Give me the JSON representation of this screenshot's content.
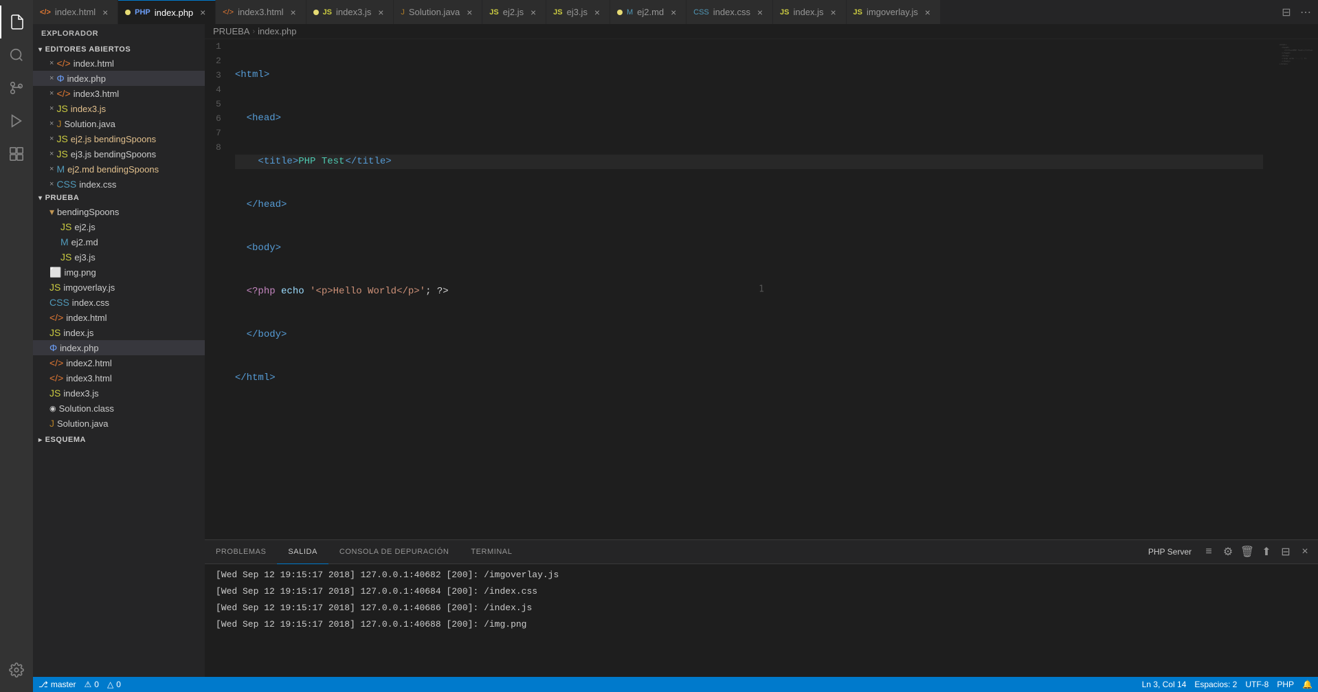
{
  "activityBar": {
    "icons": [
      {
        "name": "files-icon",
        "symbol": "⎘",
        "active": true
      },
      {
        "name": "search-icon",
        "symbol": "🔍",
        "active": false
      },
      {
        "name": "source-control-icon",
        "symbol": "⎇",
        "active": false
      },
      {
        "name": "debug-icon",
        "symbol": "▶",
        "active": false
      },
      {
        "name": "extensions-icon",
        "symbol": "⊞",
        "active": false
      }
    ],
    "bottomIcons": [
      {
        "name": "settings-icon",
        "symbol": "⚙",
        "active": false
      }
    ]
  },
  "sidebar": {
    "title": "EXPLORADOR",
    "sections": {
      "openEditors": {
        "label": "EDITORES ABIERTOS",
        "files": [
          {
            "name": "index.html",
            "icon": "html",
            "modified": false,
            "indent": 1
          },
          {
            "name": "index.php",
            "icon": "php",
            "modified": true,
            "indent": 1,
            "active": true
          },
          {
            "name": "index3.html",
            "icon": "html",
            "modified": false,
            "indent": 1
          },
          {
            "name": "index3.js",
            "icon": "js",
            "modified": true,
            "indent": 1
          },
          {
            "name": "Solution.java",
            "icon": "java",
            "modified": false,
            "indent": 1
          },
          {
            "name": "ej2.js bendingSpoons",
            "icon": "js",
            "modified": true,
            "indent": 1
          },
          {
            "name": "ej3.js bendingSpoons",
            "icon": "js",
            "modified": false,
            "indent": 1
          },
          {
            "name": "ej2.md bendingSpoons",
            "icon": "md",
            "modified": true,
            "indent": 1
          },
          {
            "name": "index.css",
            "icon": "css",
            "modified": false,
            "indent": 1
          }
        ]
      },
      "prueba": {
        "label": "PRUEBA",
        "items": [
          {
            "name": "bendingSpoons",
            "icon": "folder",
            "indent": 1
          },
          {
            "name": "ej2.js",
            "icon": "js",
            "indent": 2
          },
          {
            "name": "ej2.md",
            "icon": "md",
            "indent": 2
          },
          {
            "name": "ej3.js",
            "icon": "js",
            "indent": 2
          },
          {
            "name": "img.png",
            "icon": "png",
            "indent": 1
          },
          {
            "name": "imgoverlay.js",
            "icon": "js",
            "indent": 1
          },
          {
            "name": "index.css",
            "icon": "css",
            "indent": 1
          },
          {
            "name": "index.html",
            "icon": "html",
            "indent": 1
          },
          {
            "name": "index.js",
            "icon": "js",
            "indent": 1
          },
          {
            "name": "index.php",
            "icon": "php",
            "indent": 1,
            "active": true
          },
          {
            "name": "index2.html",
            "icon": "html",
            "indent": 1
          },
          {
            "name": "index3.html",
            "icon": "html",
            "indent": 1
          },
          {
            "name": "index3.js",
            "icon": "js",
            "indent": 1
          },
          {
            "name": "Solution.class",
            "icon": "class",
            "indent": 1
          },
          {
            "name": "Solution.java",
            "icon": "java",
            "indent": 1
          }
        ]
      },
      "schema": {
        "label": "ESQUEMA"
      }
    }
  },
  "tabs": [
    {
      "name": "index.html",
      "icon": "html",
      "active": false,
      "modified": false
    },
    {
      "name": "index.php",
      "icon": "php",
      "active": true,
      "modified": true
    },
    {
      "name": "index3.html",
      "icon": "html",
      "active": false,
      "modified": false
    },
    {
      "name": "index3.js",
      "icon": "js",
      "active": false,
      "modified": true
    },
    {
      "name": "Solution.java",
      "icon": "java",
      "active": false,
      "modified": false
    },
    {
      "name": "ej2.js",
      "icon": "js",
      "active": false,
      "modified": false
    },
    {
      "name": "ej3.js",
      "icon": "js",
      "active": false,
      "modified": false
    },
    {
      "name": "ej2.md",
      "icon": "md",
      "active": false,
      "modified": true
    },
    {
      "name": "index.css",
      "icon": "css",
      "active": false,
      "modified": false
    },
    {
      "name": "index.js",
      "icon": "js",
      "active": false,
      "modified": false
    },
    {
      "name": "imgoverlay.js",
      "icon": "js",
      "active": false,
      "modified": false
    }
  ],
  "editor": {
    "filename": "index.php",
    "lines": [
      {
        "num": 1,
        "content": "<html>",
        "tokens": [
          {
            "text": "<html>",
            "cls": "kw-tag"
          }
        ]
      },
      {
        "num": 2,
        "content": "  <head>",
        "tokens": [
          {
            "text": "  <head>",
            "cls": "kw-tag"
          }
        ]
      },
      {
        "num": 3,
        "content": "    <title>PHP Test</title>",
        "tokens": []
      },
      {
        "num": 4,
        "content": "  </head>",
        "tokens": [
          {
            "text": "  </head>",
            "cls": "kw-tag"
          }
        ]
      },
      {
        "num": 5,
        "content": "  <body>",
        "tokens": [
          {
            "text": "  <body>",
            "cls": "kw-tag"
          }
        ]
      },
      {
        "num": 6,
        "content": "  <?php echo '<p>Hello World</p>'; ?>",
        "tokens": []
      },
      {
        "num": 7,
        "content": "  </body>",
        "tokens": [
          {
            "text": "  </body>",
            "cls": "kw-tag"
          }
        ]
      },
      {
        "num": 8,
        "content": "</html>",
        "tokens": [
          {
            "text": "</html>",
            "cls": "kw-tag"
          }
        ]
      }
    ],
    "centerNum": "1"
  },
  "panel": {
    "tabs": [
      {
        "label": "PROBLEMAS",
        "active": false
      },
      {
        "label": "SALIDA",
        "active": true
      },
      {
        "label": "CONSOLA DE DEPURACIÓN",
        "active": false
      },
      {
        "label": "TERMINAL",
        "active": false
      }
    ],
    "serverLabel": "PHP Server",
    "logs": [
      "[Wed Sep 12 19:15:17 2018] 127.0.0.1:40682 [200]: /imgoverlay.js",
      "[Wed Sep 12 19:15:17 2018] 127.0.0.1:40684 [200]: /index.css",
      "[Wed Sep 12 19:15:17 2018] 127.0.0.1:40686 [200]: /index.js",
      "[Wed Sep 12 19:15:17 2018] 127.0.0.1:40688 [200]: /img.png"
    ]
  },
  "statusBar": {
    "left": [
      {
        "text": "⎇ master",
        "name": "git-branch"
      },
      {
        "text": "⚠ 0",
        "name": "errors-count"
      },
      {
        "text": "△ 0",
        "name": "warnings-count"
      }
    ],
    "right": [
      {
        "text": "Ln 3, Col 14",
        "name": "cursor-position"
      },
      {
        "text": "Espacios: 2",
        "name": "spaces"
      },
      {
        "text": "UTF-8",
        "name": "encoding"
      },
      {
        "text": "PHP",
        "name": "language"
      },
      {
        "text": "⊘",
        "name": "notifications"
      }
    ]
  },
  "icons": {
    "html": "◈",
    "php": "Ψ",
    "js": "JS",
    "java": "☕",
    "md": "M↓",
    "css": "CSS",
    "png": "🖼",
    "class": "◉",
    "folder": "📁"
  }
}
